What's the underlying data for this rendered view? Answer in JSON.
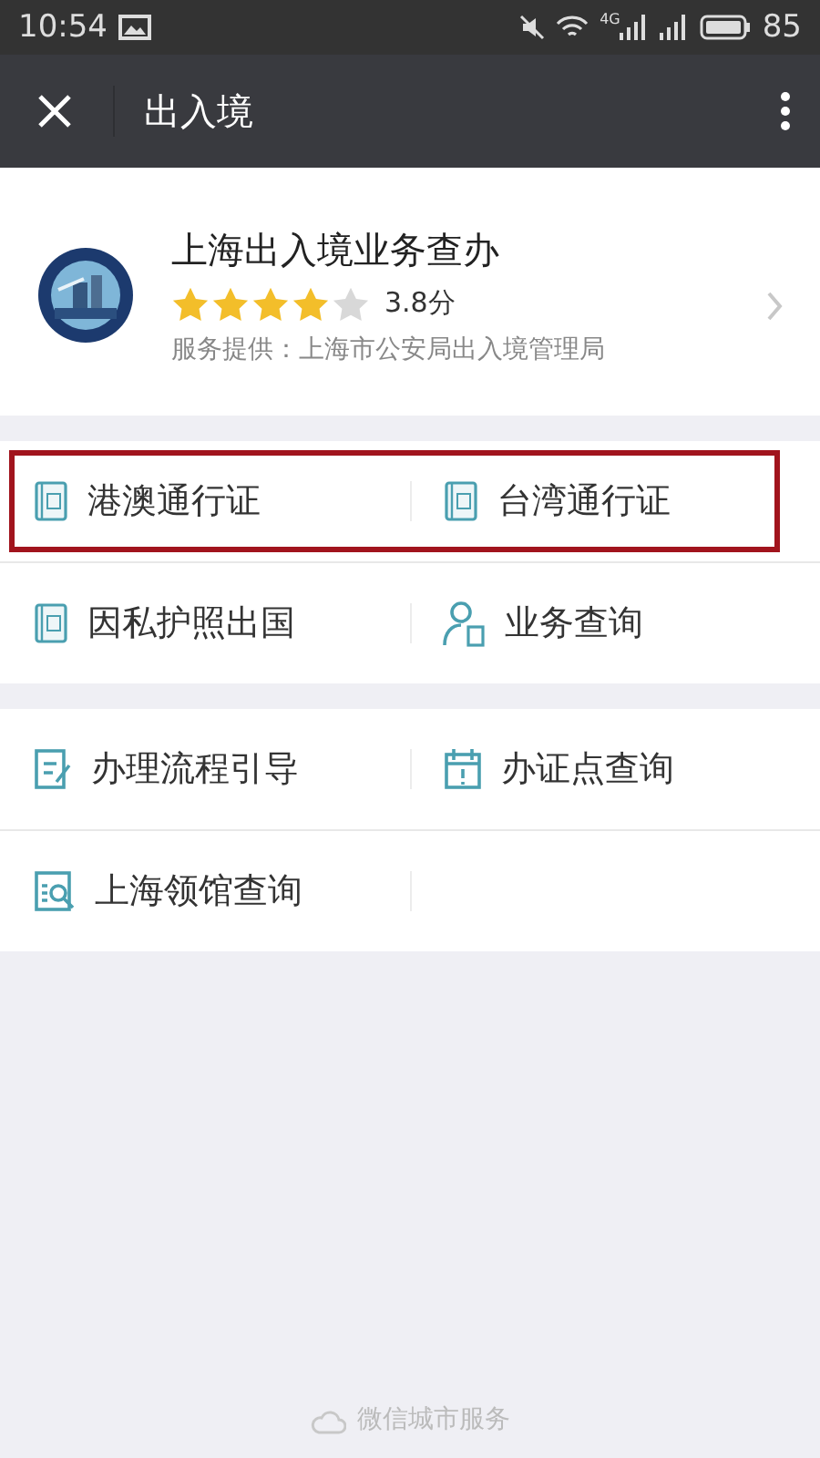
{
  "status_bar": {
    "time": "10:54",
    "battery": "85",
    "network": "4G"
  },
  "nav": {
    "title": "出入境"
  },
  "service": {
    "name": "上海出入境业务查办",
    "stars": 4,
    "score": "3.8分",
    "provider": "服务提供：上海市公安局出入境管理局"
  },
  "groups": [
    {
      "rows": [
        {
          "highlighted": true,
          "items": [
            {
              "label": "港澳通行证",
              "kind": "book"
            },
            {
              "label": "台湾通行证",
              "kind": "book"
            }
          ]
        },
        {
          "highlighted": false,
          "items": [
            {
              "label": "因私护照出国",
              "kind": "book"
            },
            {
              "label": "业务查询",
              "kind": "person"
            }
          ]
        }
      ]
    },
    {
      "rows": [
        {
          "highlighted": false,
          "items": [
            {
              "label": "办理流程引导",
              "kind": "edit"
            },
            {
              "label": "办证点查询",
              "kind": "calendar"
            }
          ]
        },
        {
          "highlighted": false,
          "items": [
            {
              "label": "上海领馆查询",
              "kind": "search"
            }
          ]
        }
      ]
    }
  ],
  "footer": {
    "text": "微信城市服务"
  }
}
